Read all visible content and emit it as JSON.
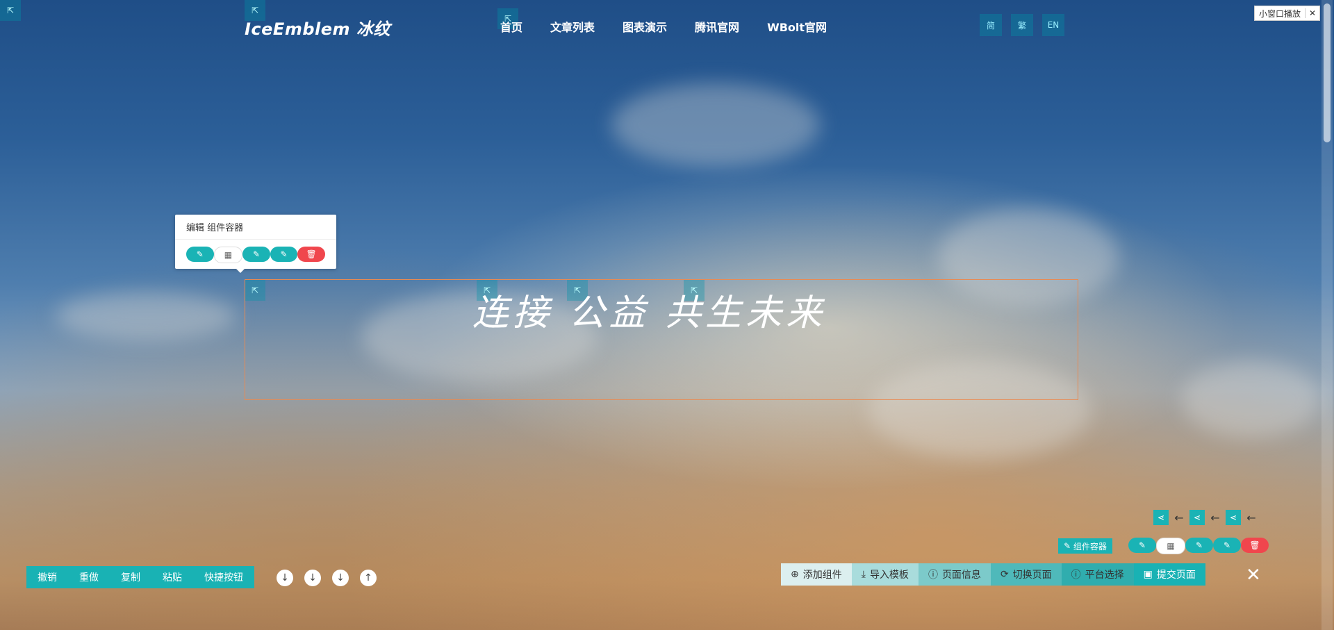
{
  "nav": {
    "logo": "IceEmblem 冰纹",
    "links": [
      "首页",
      "文章列表",
      "图表演示",
      "腾讯官网",
      "WBolt官网"
    ]
  },
  "lang": {
    "zh1": "简",
    "zh2": "繁",
    "en": "EN"
  },
  "mini_player": {
    "label": "小窗口播放",
    "close": "✕"
  },
  "edit_popup": {
    "title": "编辑 组件容器"
  },
  "hero": {
    "title": "连接 公益 共生未来"
  },
  "toolbar": {
    "undo": "撤销",
    "redo": "重做",
    "copy": "复制",
    "paste": "粘贴",
    "shortcut": "快捷按钮"
  },
  "component_tag": {
    "label": "组件容器"
  },
  "bottom_bar": {
    "add": "添加组件",
    "import": "导入模板",
    "info": "页面信息",
    "switch": "切换页面",
    "platform": "平台选择",
    "submit": "提交页面"
  },
  "colors": {
    "teal": "#19b2b4",
    "red": "#f0464d",
    "orange_border": "#e98a52"
  }
}
